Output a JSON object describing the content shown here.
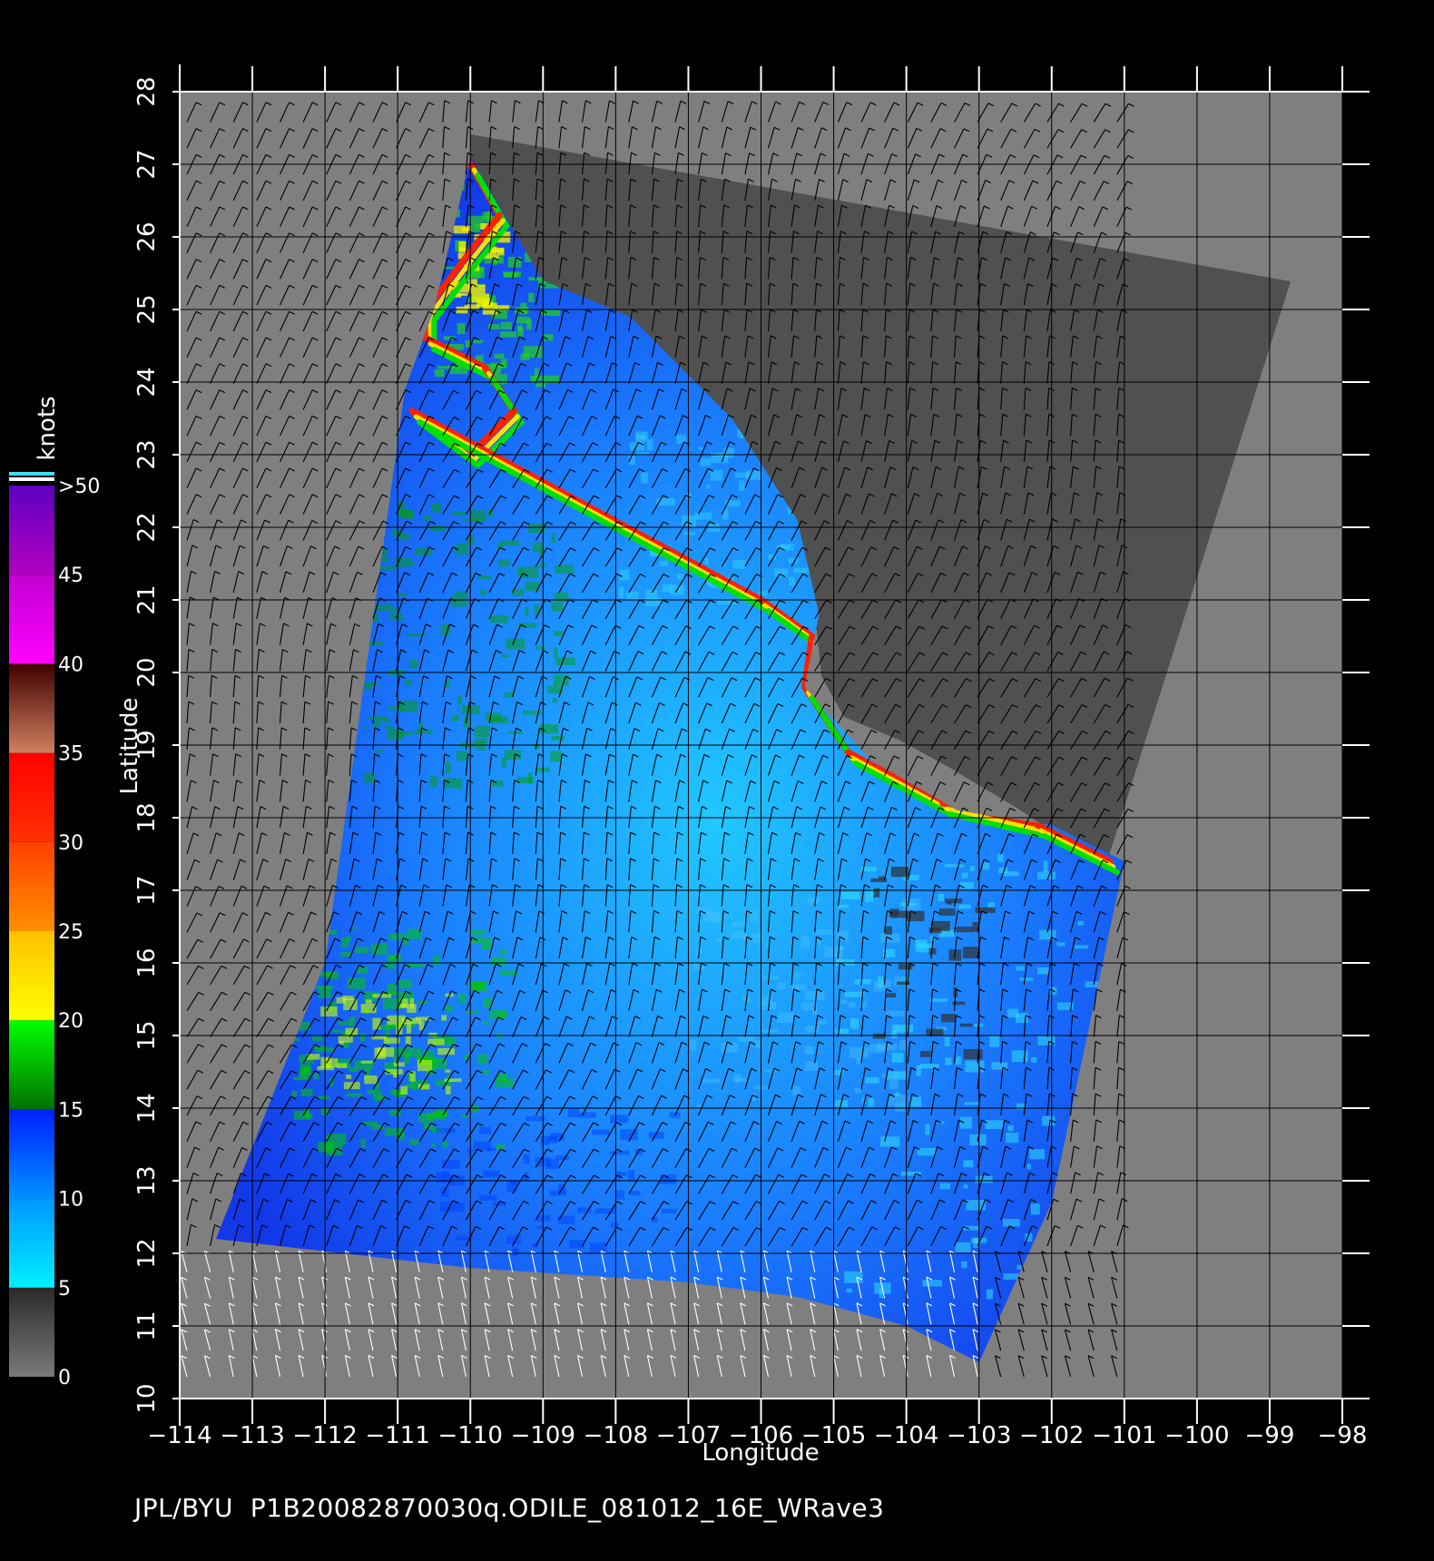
{
  "map": {
    "x_label": "Longitude",
    "y_label": "Latitude",
    "lon_range": [
      -114,
      -98
    ],
    "lat_range": [
      10,
      28
    ],
    "lon_ticks": [
      -114,
      -113,
      -112,
      -111,
      -110,
      -109,
      -108,
      -107,
      -106,
      -105,
      -104,
      -103,
      -102,
      -101,
      -100,
      -99,
      -98
    ],
    "lat_ticks": [
      10,
      11,
      12,
      13,
      14,
      15,
      16,
      17,
      18,
      19,
      20,
      21,
      22,
      23,
      24,
      25,
      26,
      27,
      28
    ],
    "grid": true,
    "colors": {
      "background": "#000000",
      "land": "#7f7f7f",
      "swath_nodata": "#4f4f4f",
      "grid": "#000000"
    },
    "wind_vectors": "barbs over ocean and land margins"
  },
  "colorbar": {
    "title": "knots",
    "labels": [
      "0",
      "5",
      "10",
      "15",
      "20",
      "25",
      "30",
      "35",
      "40",
      "45",
      ">50"
    ],
    "bands": [
      {
        "from": 0,
        "to": 5,
        "colors": [
          "#7a7a7a",
          "#2a2a2a"
        ]
      },
      {
        "from": 5,
        "to": 10,
        "colors": [
          "#00f0ff",
          "#0096ff"
        ]
      },
      {
        "from": 10,
        "to": 15,
        "colors": [
          "#0090ff",
          "#0020ff"
        ]
      },
      {
        "from": 15,
        "to": 20,
        "colors": [
          "#007000",
          "#00ff00"
        ]
      },
      {
        "from": 20,
        "to": 25,
        "colors": [
          "#ffff00",
          "#ffc000"
        ]
      },
      {
        "from": 25,
        "to": 30,
        "colors": [
          "#ff9000",
          "#ff4000"
        ]
      },
      {
        "from": 30,
        "to": 35,
        "colors": [
          "#ff3000",
          "#ff0000"
        ]
      },
      {
        "from": 35,
        "to": 40,
        "colors": [
          "#d08060",
          "#400000"
        ]
      },
      {
        "from": 40,
        "to": 45,
        "colors": [
          "#ff00ff",
          "#c000d0"
        ]
      },
      {
        "from": 45,
        "to": 50,
        "colors": [
          "#b000c0",
          "#6000c0"
        ]
      }
    ]
  },
  "footer": {
    "source": "JPL/BYU",
    "filename": "P1B20082870030q.ODILE_081012_16E_WRave3"
  }
}
